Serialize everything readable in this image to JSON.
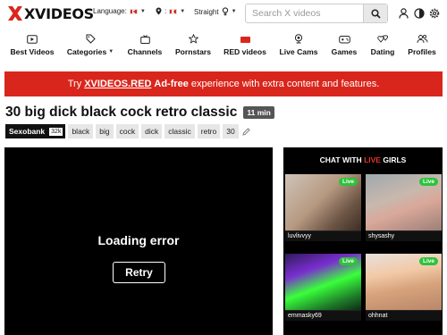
{
  "header": {
    "logo_text": "XVIDEOS",
    "language_label": "Language:",
    "country_label": ":",
    "orientation_label": "Straight",
    "search_placeholder": "Search X videos"
  },
  "nav": [
    {
      "label": "Best Videos",
      "icon": "video-icon"
    },
    {
      "label": "Categories",
      "icon": "tag-icon",
      "dropdown": true
    },
    {
      "label": "Channels",
      "icon": "channel-icon"
    },
    {
      "label": "Pornstars",
      "icon": "star-icon"
    },
    {
      "label": "RED videos",
      "icon": "red-badge-icon"
    },
    {
      "label": "Live Cams",
      "icon": "webcam-icon"
    },
    {
      "label": "Games",
      "icon": "gamepad-icon"
    },
    {
      "label": "Dating",
      "icon": "hearts-icon"
    },
    {
      "label": "Profiles",
      "icon": "profiles-icon"
    }
  ],
  "banner": {
    "prefix": "Try",
    "brand": "XVIDEOS.RED",
    "adfree": "Ad-free",
    "suffix": "experience with extra content and features."
  },
  "video": {
    "title": "30 big dick black cock retro classic",
    "duration": "11 min",
    "uploader": "Sexobank",
    "uploader_count": "32k",
    "tags": [
      "black",
      "big",
      "cock",
      "dick",
      "classic",
      "retro",
      "30"
    ]
  },
  "player": {
    "error_text": "Loading error",
    "retry_label": "Retry"
  },
  "cams": {
    "heading_pre": "CHAT WITH",
    "heading_live": "LIVE",
    "heading_post": "GIRLS",
    "live_badge": "Live",
    "items": [
      {
        "name": "luvlivvyy"
      },
      {
        "name": "shysashy"
      },
      {
        "name": "emmasky69"
      },
      {
        "name": "ohhnat"
      }
    ]
  },
  "colors": {
    "brand_red": "#d9261c",
    "live_green": "#2ec23b"
  }
}
